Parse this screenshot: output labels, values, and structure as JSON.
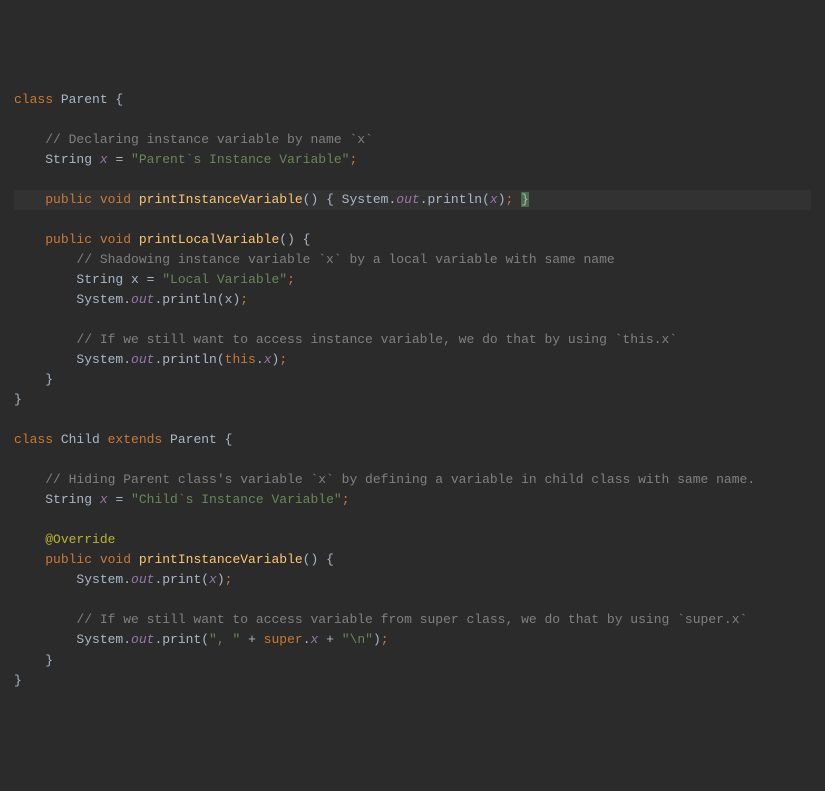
{
  "code": {
    "l1_kw1": "class",
    "l1_name": " Parent {",
    "l2_com": "    // Declaring instance variable by name `x`",
    "l3_indent": "    ",
    "l3_type": "String ",
    "l3_var": "x",
    "l3_eq": " = ",
    "l3_str": "\"Parent`s Instance Variable\"",
    "l3_term": ";",
    "l4_indent": "    ",
    "l4_kw1": "public void ",
    "l4_mtd": "printInstanceVariable",
    "l4_rest": "() { System.",
    "l4_out": "out",
    "l4_p1": ".println(",
    "l4_x": "x",
    "l4_p2": ")",
    "l4_semi": "; ",
    "l4_close": "}",
    "l5_indent": "    ",
    "l5_kw1": "public void ",
    "l5_mtd": "printLocalVariable",
    "l5_rest": "() {",
    "l6_com": "        // Shadowing instance variable `x` by a local variable with same name",
    "l7_indent": "        ",
    "l7_type": "String ",
    "l7_var": "x = ",
    "l7_str": "\"Local Variable\"",
    "l7_term": ";",
    "l8_indent": "        ",
    "l8_sys": "System.",
    "l8_out": "out",
    "l8_p1": ".println(x)",
    "l8_term": ";",
    "l9_com": "        // If we still want to access instance variable, we do that by using `this.x`",
    "l10_indent": "        ",
    "l10_sys": "System.",
    "l10_out": "out",
    "l10_p1": ".println(",
    "l10_this": "this",
    "l10_dot": ".",
    "l10_x": "x",
    "l10_p2": ")",
    "l10_term": ";",
    "l11": "    }",
    "l12": "}",
    "l13_kw1": "class",
    "l13_name": " Child ",
    "l13_kw2": "extends",
    "l13_name2": " Parent {",
    "l14_com": "    // Hiding Parent class's variable `x` by defining a variable in child class with same name.",
    "l15_indent": "    ",
    "l15_type": "String ",
    "l15_var": "x",
    "l15_eq": " = ",
    "l15_str": "\"Child`s Instance Variable\"",
    "l15_term": ";",
    "l16_indent": "    ",
    "l16_ann": "@Override",
    "l17_indent": "    ",
    "l17_kw1": "public void ",
    "l17_mtd": "printInstanceVariable",
    "l17_rest": "() {",
    "l18_indent": "        ",
    "l18_sys": "System.",
    "l18_out": "out",
    "l18_p1": ".print(",
    "l18_x": "x",
    "l18_p2": ")",
    "l18_term": ";",
    "l19_com": "        // If we still want to access variable from super class, we do that by using `super.x`",
    "l20_indent": "        ",
    "l20_sys": "System.",
    "l20_out": "out",
    "l20_p1": ".print(",
    "l20_str1": "\", \"",
    "l20_plus1": " + ",
    "l20_super": "super",
    "l20_dot": ".",
    "l20_x": "x",
    "l20_plus2": " + ",
    "l20_str2": "\"\\n\"",
    "l20_p2": ")",
    "l20_term": ";",
    "l21": "    }",
    "l22": "}"
  }
}
